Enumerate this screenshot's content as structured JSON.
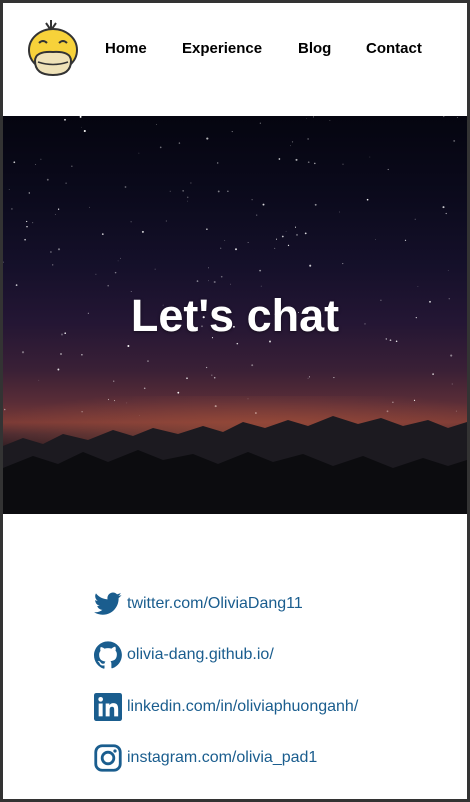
{
  "nav": {
    "logo_icon": "psyduck-logo-icon",
    "items": [
      {
        "label": "Home"
      },
      {
        "label": "Experience"
      },
      {
        "label": "Blog"
      },
      {
        "label": "Contact"
      }
    ]
  },
  "hero": {
    "title": "Let's chat"
  },
  "links": [
    {
      "icon": "twitter-icon",
      "text": "twitter.com/OliviaDang11"
    },
    {
      "icon": "github-icon",
      "text": "olivia-dang.github.io/"
    },
    {
      "icon": "linkedin-icon",
      "text": "linkedin.com/in/oliviaphuonganh/"
    },
    {
      "icon": "instagram-icon",
      "text": "instagram.com/olivia_pad1"
    }
  ],
  "colors": {
    "link": "#1a5d8e",
    "icon": "#1a5d8e",
    "frame": "#333333"
  }
}
